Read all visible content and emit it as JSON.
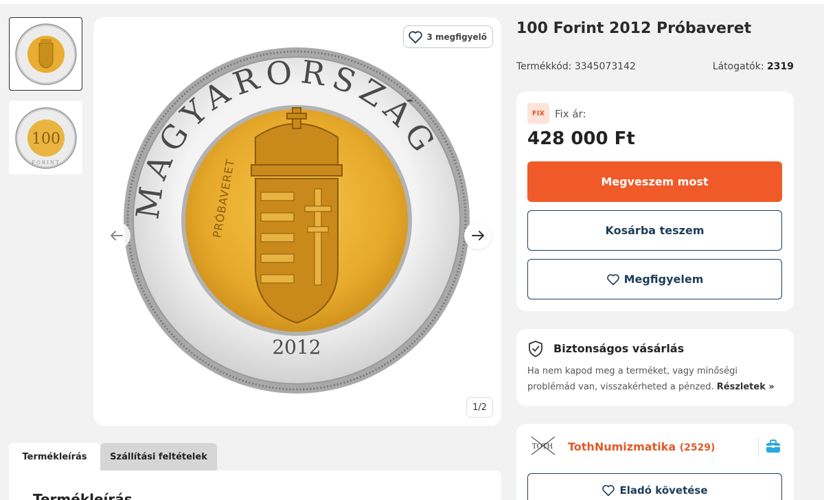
{
  "product": {
    "title": "100 Forint 2012 Próbaveret",
    "code_label": "Termékkód: 3345073142",
    "visitors_label": "Látogatók:",
    "visitors_count": "2319"
  },
  "gallery": {
    "watchers_label": "3 megfigyelő",
    "counter": "1/2",
    "coin_legend": "MAGYARORSZÁG",
    "coin_year": "2012",
    "coin_proof_text": "PRÓBAVERET",
    "thumb2_legend": "FORINT",
    "thumb2_value": "100"
  },
  "tabs": [
    {
      "label": "Termékleírás"
    },
    {
      "label": "Szállítási feltételek"
    }
  ],
  "description": {
    "heading": "Termékleírás"
  },
  "price_box": {
    "badge": "FIX",
    "fix_label": "Fix ár:",
    "price": "428 000 Ft",
    "buy_label": "Megveszem most",
    "cart_label": "Kosárba teszem",
    "watch_label": "Megfigyelem"
  },
  "secure": {
    "title": "Biztonságos vásárlás",
    "text": "Ha nem kapod meg a terméket, vagy minőségi problémád van, visszakérheted a pénzed.",
    "link": "Részletek »"
  },
  "seller": {
    "name": "TothNumizmatika",
    "rating": "(2529)",
    "logo_text": "TOTH",
    "follow_label": "Eladó követése"
  },
  "colors": {
    "accent": "#f05a28",
    "navy": "#1c3d5a",
    "background": "#f2f2f2",
    "coin_gold": "#e6a82a",
    "coin_silver": "#d9d9d9"
  }
}
